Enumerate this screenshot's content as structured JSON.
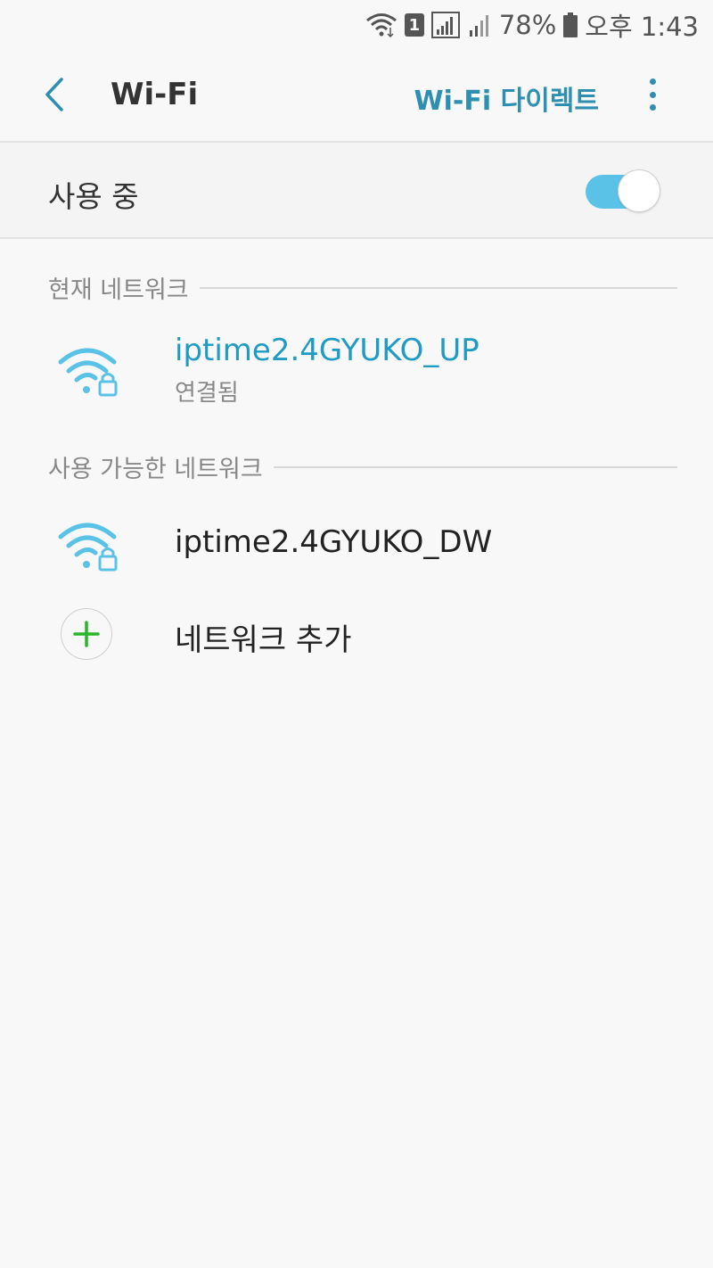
{
  "status_bar": {
    "battery": "78%",
    "time": "오후 1:43",
    "sim_slot": "1"
  },
  "header": {
    "title": "Wi-Fi",
    "action": "Wi-Fi 다이렉트"
  },
  "master_switch": {
    "label": "사용 중",
    "enabled": true
  },
  "current_network": {
    "section_label": "현재 네트워크",
    "name": "iptime2.4GYUKO_UP",
    "status": "연결됨"
  },
  "available_networks": {
    "section_label": "사용 가능한 네트워크",
    "items": [
      {
        "name": "iptime2.4GYUKO_DW"
      }
    ]
  },
  "add_network": {
    "label": "네트워크 추가"
  },
  "colors": {
    "accent": "#2f8fb1",
    "connected": "#1f9bc4",
    "toggle_on": "#5bc2e7",
    "wifi_icon": "#5bc2e7",
    "add_plus": "#2bb52b"
  }
}
